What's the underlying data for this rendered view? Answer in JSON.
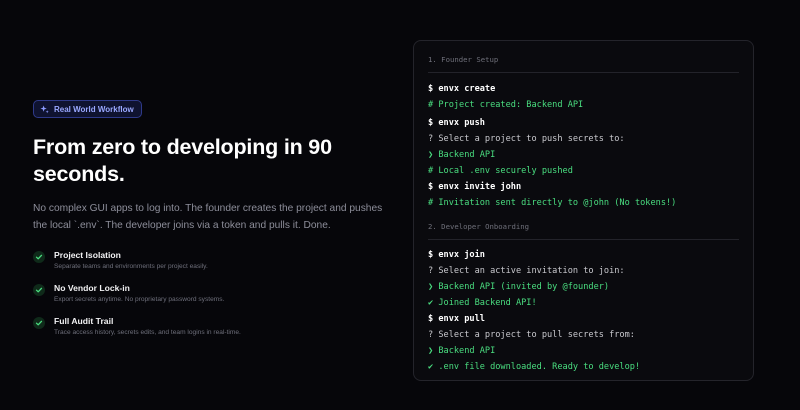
{
  "badge": {
    "label": "Real World Workflow",
    "icon": "sparkle-icon"
  },
  "hero": {
    "title": "From zero to developing in 90 seconds.",
    "lead": "No complex GUI apps to log into. The founder creates the project and pushes the local `.env`. The developer joins via a token and pulls it. Done."
  },
  "features": [
    {
      "title": "Project Isolation",
      "desc": "Separate teams and environments per project easily."
    },
    {
      "title": "No Vendor Lock-in",
      "desc": "Export secrets anytime. No proprietary password systems."
    },
    {
      "title": "Full Audit Trail",
      "desc": "Trace access history, secrets edits, and team logins in real-time."
    }
  ],
  "colors": {
    "accent": "#4ade80",
    "badge": "#9aa8ff",
    "background": "#06060a"
  },
  "terminal": {
    "section1": "1. Founder Setup",
    "create": {
      "cmd": "$ envx create",
      "out": "# Project created: Backend API"
    },
    "push": {
      "cmd": "$ envx push",
      "prompt": "? Select a project to push secrets to:",
      "choice": "❯ Backend API",
      "out": "# Local .env securely pushed"
    },
    "invite": {
      "cmd": "$ envx invite john",
      "out": "# Invitation sent directly to @john (No tokens!)"
    },
    "section2": "2. Developer Onboarding",
    "join": {
      "cmd": "$ envx join",
      "prompt": "? Select an active invitation to join:",
      "choice": "❯ Backend API (invited by @founder)",
      "out": "✔ Joined Backend API!"
    },
    "pull": {
      "cmd": "$ envx pull",
      "prompt": "? Select a project to pull secrets from:",
      "choice": "❯ Backend API",
      "out": "✔ .env file downloaded. Ready to develop!"
    }
  }
}
